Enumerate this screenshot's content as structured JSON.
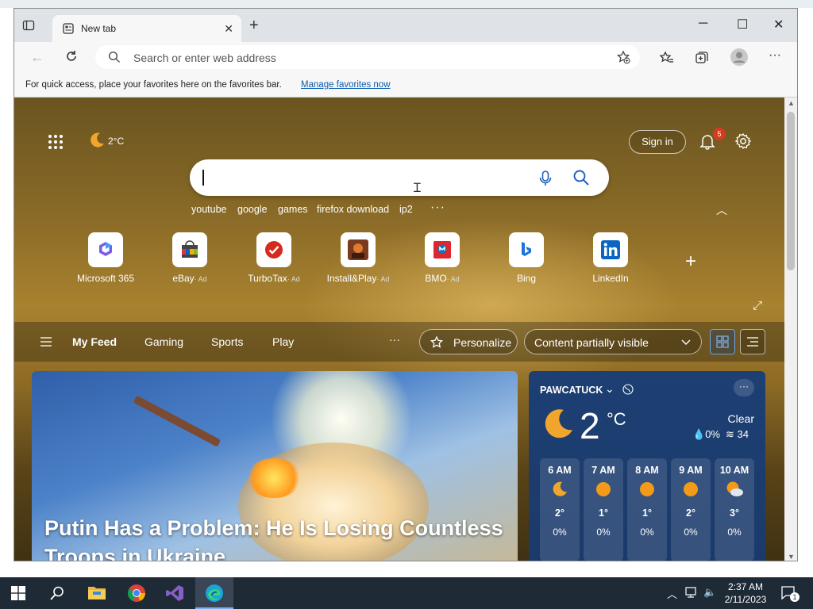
{
  "browser": {
    "tab_title": "New tab",
    "address_placeholder": "Search or enter web address",
    "favorites_bar_message": "For quick access, place your favorites here on the favorites bar.",
    "favorites_bar_link": "Manage favorites now"
  },
  "ntp": {
    "weather_temp": "2°C",
    "sign_in": "Sign in",
    "notification_count": "5",
    "suggestions": [
      "youtube",
      "google",
      "games",
      "firefox download",
      "ip2"
    ],
    "tiles": [
      {
        "label": "Microsoft 365",
        "ad": "",
        "icon": "microsoft365-icon"
      },
      {
        "label": "eBay",
        "ad": "· Ad",
        "icon": "ebay-icon"
      },
      {
        "label": "TurboTax",
        "ad": "· Ad",
        "icon": "turbotax-icon"
      },
      {
        "label": "Install&Play",
        "ad": "· Ad",
        "icon": "installplay-icon"
      },
      {
        "label": "BMO",
        "ad": "· Ad",
        "icon": "bmo-icon"
      },
      {
        "label": "Bing",
        "ad": "",
        "icon": "bing-icon"
      },
      {
        "label": "LinkedIn",
        "ad": "",
        "icon": "linkedin-icon"
      }
    ],
    "feed": {
      "items": [
        "My Feed",
        "Gaming",
        "Sports",
        "Play"
      ],
      "personalize": "Personalize",
      "content_visibility": "Content partially visible"
    },
    "hero": {
      "headline": "Putin Has a Problem: He Is Losing Countless Troops in Ukraine"
    },
    "weather": {
      "location": "PAWCATUCK",
      "temp": "2",
      "unit": "°C",
      "condition": "Clear",
      "precip": "0%",
      "wind": "34",
      "hours": [
        {
          "time": "6 AM",
          "temp": "2°",
          "precip": "0%",
          "icon": "moon"
        },
        {
          "time": "7 AM",
          "temp": "1°",
          "precip": "0%",
          "icon": "sun"
        },
        {
          "time": "8 AM",
          "temp": "1°",
          "precip": "0%",
          "icon": "sun"
        },
        {
          "time": "9 AM",
          "temp": "2°",
          "precip": "0%",
          "icon": "sun"
        },
        {
          "time": "10 AM",
          "temp": "3°",
          "precip": "0%",
          "icon": "partly-cloudy"
        }
      ]
    }
  },
  "taskbar": {
    "time": "2:37 AM",
    "date": "2/11/2023",
    "notification_count": "1"
  },
  "colors": {
    "accent": "#0b5cad",
    "taskbar": "#1f2a37",
    "weather_card": "#1d3f73"
  }
}
